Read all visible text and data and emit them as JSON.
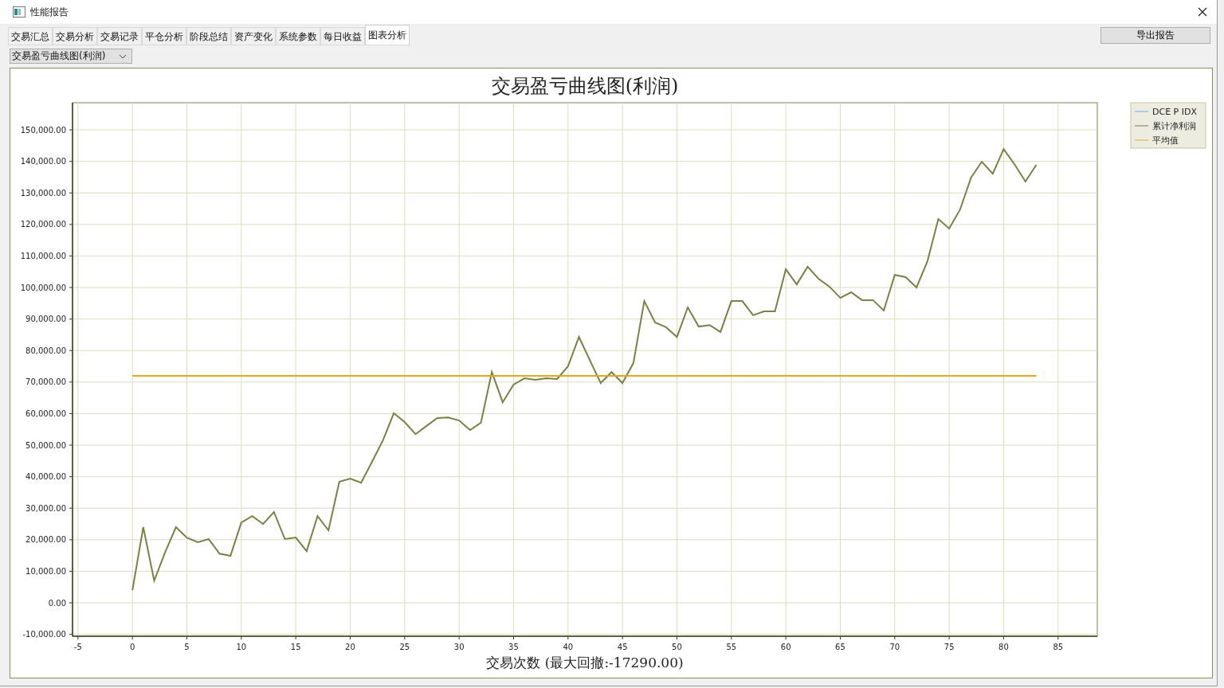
{
  "window": {
    "title": "性能报告"
  },
  "tabs": [
    {
      "label": "交易汇总",
      "selected": false
    },
    {
      "label": "交易分析",
      "selected": false
    },
    {
      "label": "交易记录",
      "selected": false
    },
    {
      "label": "平仓分析",
      "selected": false
    },
    {
      "label": "阶段总结",
      "selected": false
    },
    {
      "label": "资产变化",
      "selected": false
    },
    {
      "label": "系统参数",
      "selected": false
    },
    {
      "label": "每日收益",
      "selected": false
    },
    {
      "label": "图表分析",
      "selected": true
    }
  ],
  "export_button": "导出报告",
  "chart_selector": {
    "value": "交易盈亏曲线图(利润)"
  },
  "chart": {
    "chart_data": {
      "type": "line",
      "title": "交易盈亏曲线图(利润)",
      "xlabel": "交易次数 (最大回撤:-17290.00)",
      "x": [
        0,
        1,
        2,
        3,
        4,
        5,
        6,
        7,
        8,
        9,
        10,
        11,
        12,
        13,
        14,
        15,
        16,
        17,
        18,
        19,
        20,
        21,
        22,
        23,
        24,
        25,
        26,
        27,
        28,
        29,
        30,
        31,
        32,
        33,
        34,
        35,
        36,
        37,
        38,
        39,
        40,
        41,
        42,
        43,
        44,
        45,
        46,
        47,
        48,
        49,
        50,
        51,
        52,
        53,
        54,
        55,
        56,
        57,
        58,
        59,
        60,
        61,
        62,
        63,
        64,
        65,
        66,
        67,
        68,
        69,
        70,
        71,
        72,
        73,
        74,
        75,
        76,
        77,
        78,
        79,
        80,
        81,
        82,
        83
      ],
      "series": [
        {
          "name": "DCE P IDX",
          "color": "#6fa8dc",
          "values": [
            null,
            null,
            null,
            null,
            null,
            null,
            null,
            null,
            null,
            null,
            null,
            null,
            null,
            null,
            null,
            null,
            null,
            null,
            null,
            null,
            null,
            null,
            null,
            null,
            null,
            null,
            null,
            null,
            null,
            null,
            null,
            null,
            null,
            null,
            null,
            null,
            null,
            null,
            null,
            null,
            null,
            null,
            null,
            null,
            null,
            null,
            null,
            null,
            null,
            null,
            null,
            null,
            null,
            null,
            null,
            null,
            null,
            null,
            null,
            null,
            null,
            null,
            null,
            null,
            null,
            null,
            null,
            null,
            null,
            null,
            null,
            null,
            null,
            null,
            null,
            null,
            null,
            null,
            null,
            null,
            null,
            null,
            null,
            null
          ]
        },
        {
          "name": "累计净利润",
          "color": "#7a8048",
          "values": [
            4000,
            24000,
            7000,
            16000,
            24000,
            20700,
            19200,
            20200,
            15600,
            14900,
            25500,
            27500,
            25000,
            28800,
            20200,
            20700,
            16400,
            27500,
            23000,
            38400,
            39400,
            38100,
            44700,
            51500,
            60100,
            57300,
            53500,
            56100,
            58600,
            58800,
            57800,
            54800,
            57100,
            73200,
            63600,
            69200,
            71200,
            70700,
            71200,
            71000,
            75000,
            84300,
            77000,
            69700,
            73200,
            69700,
            76000,
            95700,
            88900,
            87400,
            84300,
            93700,
            87600,
            88100,
            85900,
            95700,
            95700,
            91200,
            92400,
            92400,
            105800,
            101000,
            106600,
            102800,
            100300,
            96700,
            98500,
            96000,
            96000,
            92700,
            104000,
            103300,
            100000,
            108300,
            121700,
            118700,
            124700,
            134800,
            139900,
            136100,
            143900,
            139100,
            133600,
            138900
          ]
        },
        {
          "name": "平均值",
          "color": "#e8a317",
          "values": [
            72000,
            72000,
            72000,
            72000,
            72000,
            72000,
            72000,
            72000,
            72000,
            72000,
            72000,
            72000,
            72000,
            72000,
            72000,
            72000,
            72000,
            72000,
            72000,
            72000,
            72000,
            72000,
            72000,
            72000,
            72000,
            72000,
            72000,
            72000,
            72000,
            72000,
            72000,
            72000,
            72000,
            72000,
            72000,
            72000,
            72000,
            72000,
            72000,
            72000,
            72000,
            72000,
            72000,
            72000,
            72000,
            72000,
            72000,
            72000,
            72000,
            72000,
            72000,
            72000,
            72000,
            72000,
            72000,
            72000,
            72000,
            72000,
            72000,
            72000,
            72000,
            72000,
            72000,
            72000,
            72000,
            72000,
            72000,
            72000,
            72000,
            72000,
            72000,
            72000,
            72000,
            72000,
            72000,
            72000,
            72000,
            72000,
            72000,
            72000,
            72000,
            72000,
            72000,
            72000
          ]
        }
      ],
      "grid": true,
      "legend": true,
      "xlim": [
        -5.5,
        88.6
      ],
      "ylim": [
        -10600,
        158600
      ],
      "xticks": [
        -5,
        0,
        5,
        10,
        15,
        20,
        25,
        30,
        35,
        40,
        45,
        50,
        55,
        60,
        65,
        70,
        75,
        80,
        85
      ],
      "yticks": [
        {
          "value": -10000,
          "label": "-10,000.00"
        },
        {
          "value": 0,
          "label": "0.00"
        },
        {
          "value": 10000,
          "label": "10,000.00"
        },
        {
          "value": 20000,
          "label": "20,000.00"
        },
        {
          "value": 30000,
          "label": "30,000.00"
        },
        {
          "value": 40000,
          "label": "40,000.00"
        },
        {
          "value": 50000,
          "label": "50,000.00"
        },
        {
          "value": 60000,
          "label": "60,000.00"
        },
        {
          "value": 70000,
          "label": "70,000.00"
        },
        {
          "value": 80000,
          "label": "80,000.00"
        },
        {
          "value": 90000,
          "label": "90,000.00"
        },
        {
          "value": 100000,
          "label": "100,000.00"
        },
        {
          "value": 110000,
          "label": "110,000.00"
        },
        {
          "value": 120000,
          "label": "120,000.00"
        },
        {
          "value": 130000,
          "label": "130,000.00"
        },
        {
          "value": 140000,
          "label": "140,000.00"
        },
        {
          "value": 150000,
          "label": "150,000.00"
        }
      ]
    }
  }
}
